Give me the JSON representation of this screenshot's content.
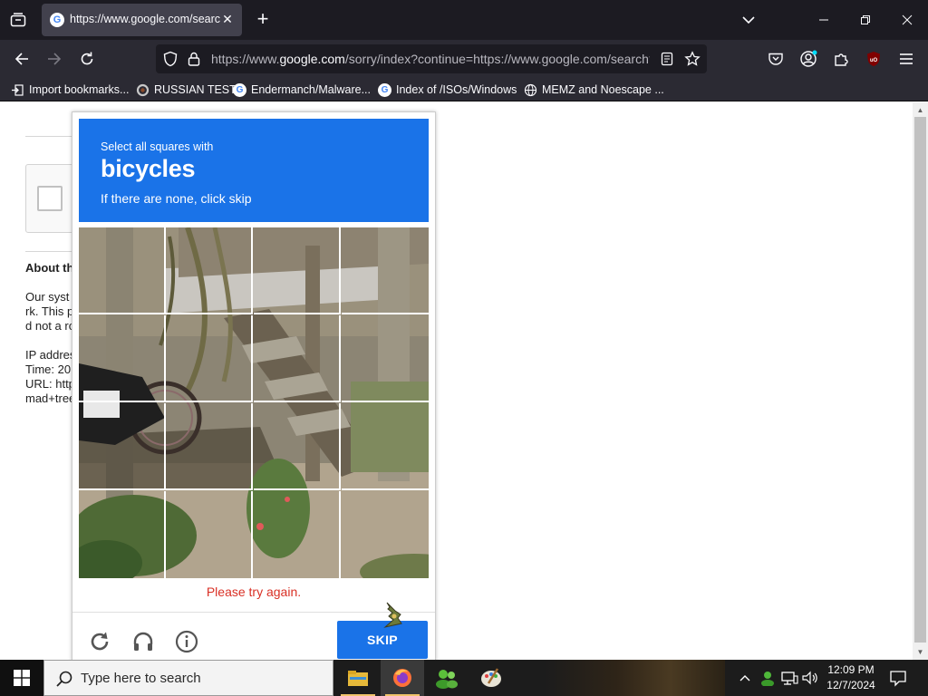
{
  "browser": {
    "tab": {
      "title": "https://www.google.com/search?q=...",
      "favicon": "google-g"
    },
    "url": {
      "prefix": "https://www.",
      "host": "google.com",
      "path": "/sorry/index?continue=https://www.google.com/search?"
    },
    "bookmarks": [
      {
        "label": "Import bookmarks...",
        "icon": "import-icon"
      },
      {
        "label": "RUSSIAN TEST",
        "icon": "ring-icon"
      },
      {
        "label": "Endermanch/Malware...",
        "icon": "google-icon"
      },
      {
        "label": "Index of /ISOs/Windows",
        "icon": "google-icon"
      },
      {
        "label": "MEMZ and Noescape ...",
        "icon": "globe-icon"
      }
    ]
  },
  "page": {
    "about_title": "About th",
    "about_lines": [
      "Our syst",
      "rk. This p",
      "d not a ro",
      "",
      "IP addres",
      "Time: 20",
      "URL: http",
      "mad+tree"
    ]
  },
  "captcha": {
    "header_line1": "Select all squares with",
    "keyword": "bicycles",
    "header_line3": "If there are none, click skip",
    "error_text": "Please try again.",
    "skip_label": "SKIP",
    "colors": {
      "accent": "#1a73e8",
      "error": "#d93025"
    }
  },
  "taskbar": {
    "search_placeholder": "Type here to search",
    "time": "12:09 PM",
    "date": "12/7/2024"
  }
}
